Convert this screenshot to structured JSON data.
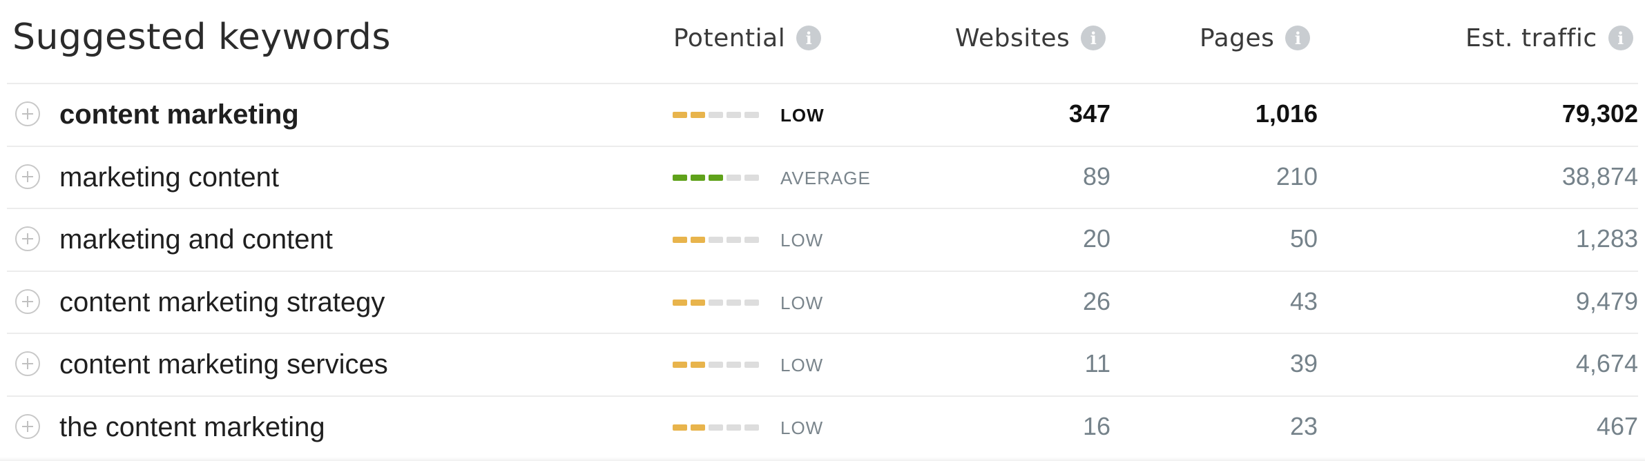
{
  "title": "Suggested keywords",
  "columns": {
    "potential": "Potential",
    "websites": "Websites",
    "pages": "Pages",
    "traffic": "Est. traffic"
  },
  "info_icon_glyph": "i",
  "colors": {
    "low": "#e8b44c",
    "average": "#5fa21a",
    "empty_bar": "#dddddd"
  },
  "rows": [
    {
      "keyword": "content marketing",
      "potential": "LOW",
      "level": 2,
      "websites": "347",
      "pages": "1,016",
      "traffic": "79,302"
    },
    {
      "keyword": "marketing content",
      "potential": "AVERAGE",
      "level": 3,
      "websites": "89",
      "pages": "210",
      "traffic": "38,874"
    },
    {
      "keyword": "marketing and content",
      "potential": "LOW",
      "level": 2,
      "websites": "20",
      "pages": "50",
      "traffic": "1,283"
    },
    {
      "keyword": "content marketing strategy",
      "potential": "LOW",
      "level": 2,
      "websites": "26",
      "pages": "43",
      "traffic": "9,479"
    },
    {
      "keyword": "content marketing services",
      "potential": "LOW",
      "level": 2,
      "websites": "11",
      "pages": "39",
      "traffic": "4,674"
    },
    {
      "keyword": "the content marketing",
      "potential": "LOW",
      "level": 2,
      "websites": "16",
      "pages": "23",
      "traffic": "467"
    }
  ]
}
